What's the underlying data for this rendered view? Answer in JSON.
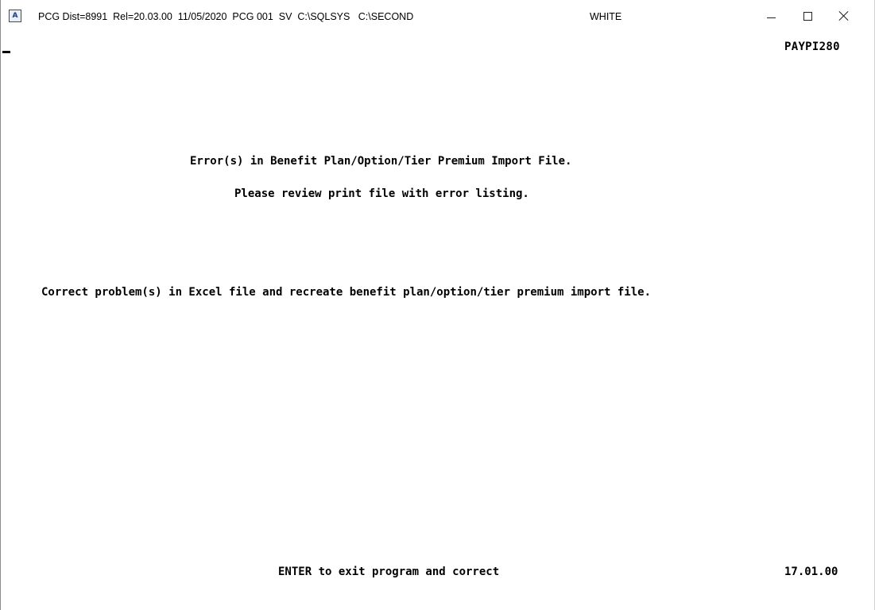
{
  "titlebar": {
    "icon": "terminal-app-icon",
    "icon_letter": "A",
    "title": "PCG Dist=8991  Rel=20.03.00  11/05/2020  PCG 001  SV  C:\\SQLSYS   C:\\SECOND",
    "theme": "WHITE",
    "minimize_icon": "minimize-icon",
    "maximize_icon": "maximize-icon",
    "close_icon": "close-icon"
  },
  "screen": {
    "program_id": "PAYPI280",
    "error_heading": "Error(s) in Benefit Plan/Option/Tier Premium Import File.",
    "review_message": "Please review print file with error listing.",
    "correct_message": "Correct problem(s) in Excel file and recreate benefit plan/option/tier premium import file.",
    "footer_instruction": "ENTER to exit program and correct",
    "time": "17.01.00"
  },
  "colors": {
    "background": "#ffffff",
    "text": "#000000"
  }
}
